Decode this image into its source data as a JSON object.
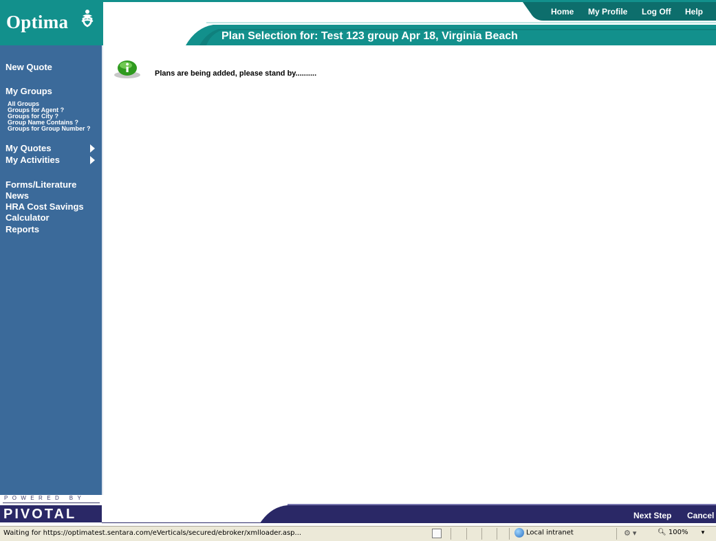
{
  "header": {
    "logo_text": "Optima",
    "page_heading": "Plan Selection for: Test 123 group Apr 18, Virginia Beach",
    "nav": {
      "home": "Home",
      "my_profile": "My Profile",
      "log_off": "Log Off",
      "help": "Help"
    },
    "colors": {
      "teal": "#12908c",
      "sidebar": "#3b6a9a",
      "footer": "#2a2866"
    }
  },
  "sidebar": {
    "new_quote": "New Quote",
    "my_groups": "My Groups",
    "group_links": [
      "All Groups",
      "Groups for Agent ?",
      "Groups for City ?",
      "Group Name Contains ?",
      "Groups for Group Number ?"
    ],
    "my_quotes": "My Quotes",
    "my_activities": "My Activities",
    "links": [
      "Forms/Literature",
      "News",
      "HRA Cost Savings",
      "Calculator",
      "Reports"
    ],
    "powered_by": "POWERED BY",
    "pivotal": "PIVOTAL"
  },
  "main": {
    "info_icon": "info-icon",
    "status_message": "Plans are being added, please stand by.........."
  },
  "footer": {
    "next_step": "Next Step",
    "cancel": "Cancel"
  },
  "browser_status": {
    "text": "Waiting for https://optimatest.sentara.com/eVerticals/secured/ebroker/xmlloader.asp...",
    "zone": "Local intranet",
    "zoom": "100%"
  }
}
